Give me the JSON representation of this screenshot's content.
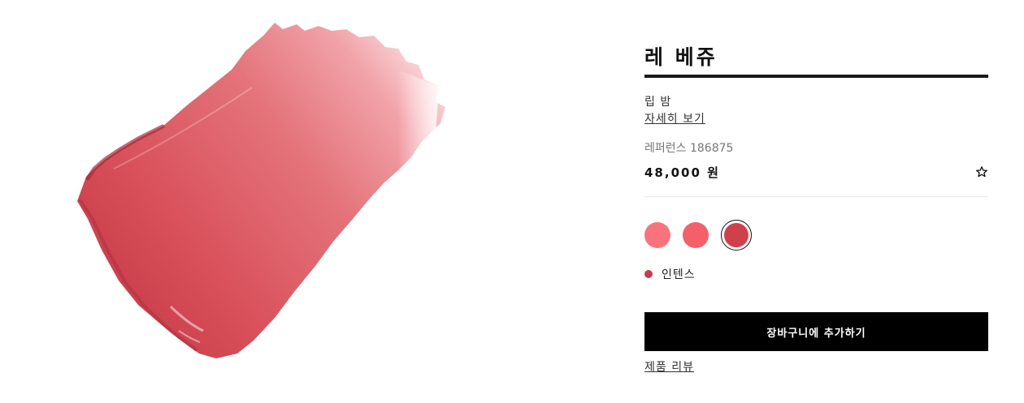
{
  "product": {
    "name": "레 베쥬",
    "category": "립 밤",
    "details_link": "자세히 보기",
    "reference": "레퍼런스 186875",
    "price": "48,000 원"
  },
  "shades": {
    "options": [
      {
        "color": "#f9737d"
      },
      {
        "color": "#f55f6a"
      },
      {
        "color": "#d0404b",
        "selected": true
      }
    ],
    "selected_name": "인텐스",
    "selected_color": "#c8394a"
  },
  "actions": {
    "add_to_cart": "장바구니에 추가하기",
    "reviews": "제품 리뷰"
  },
  "icons": {
    "wishlist": "star-outline-icon"
  }
}
